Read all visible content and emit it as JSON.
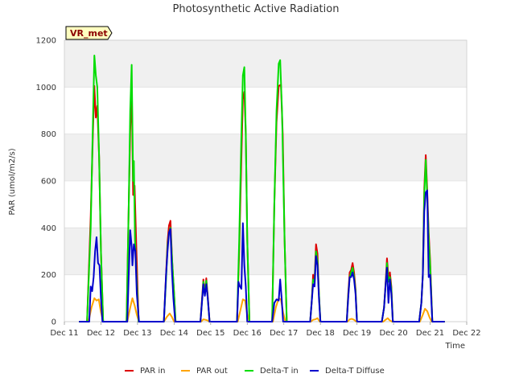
{
  "chart_data": {
    "type": "line",
    "title": "Photosynthetic Active Radiation",
    "xlabel": "Time",
    "ylabel": "PAR (umol/m2/s)",
    "ylim": [
      0,
      1200
    ],
    "xlim": [
      0,
      11
    ],
    "yticks": [
      0,
      200,
      400,
      600,
      800,
      1000,
      1200
    ],
    "xtick_labels": [
      "Dec 11",
      "Dec 12",
      "Dec 13",
      "Dec 14",
      "Dec 15",
      "Dec 16",
      "Dec 17",
      "Dec 18",
      "Dec 19",
      "Dec 20",
      "Dec 21",
      "Dec 22"
    ],
    "grid": true,
    "legend_position": "bottom",
    "badge": "VR_met",
    "series": [
      {
        "name": "PAR in",
        "color": "#dd0000",
        "points": [
          [
            0.4,
            0
          ],
          [
            0.62,
            0
          ],
          [
            0.72,
            450
          ],
          [
            0.78,
            800
          ],
          [
            0.82,
            1005
          ],
          [
            0.86,
            870
          ],
          [
            0.9,
            920
          ],
          [
            0.95,
            700
          ],
          [
            1.0,
            300
          ],
          [
            1.06,
            0
          ],
          [
            1.7,
            0
          ],
          [
            1.76,
            500
          ],
          [
            1.8,
            810
          ],
          [
            1.84,
            1000
          ],
          [
            1.88,
            540
          ],
          [
            1.92,
            580
          ],
          [
            1.97,
            300
          ],
          [
            2.03,
            0
          ],
          [
            2.72,
            0
          ],
          [
            2.78,
            200
          ],
          [
            2.82,
            340
          ],
          [
            2.86,
            410
          ],
          [
            2.9,
            430
          ],
          [
            2.95,
            250
          ],
          [
            3.0,
            120
          ],
          [
            3.04,
            0
          ],
          [
            3.72,
            0
          ],
          [
            3.76,
            90
          ],
          [
            3.8,
            180
          ],
          [
            3.84,
            120
          ],
          [
            3.88,
            185
          ],
          [
            3.92,
            110
          ],
          [
            3.97,
            0
          ],
          [
            4.72,
            0
          ],
          [
            4.78,
            300
          ],
          [
            4.84,
            700
          ],
          [
            4.88,
            950
          ],
          [
            4.92,
            980
          ],
          [
            4.96,
            800
          ],
          [
            5.0,
            350
          ],
          [
            5.06,
            0
          ],
          [
            5.68,
            0
          ],
          [
            5.74,
            500
          ],
          [
            5.8,
            850
          ],
          [
            5.86,
            1005
          ],
          [
            5.92,
            1010
          ],
          [
            5.97,
            800
          ],
          [
            6.02,
            350
          ],
          [
            6.08,
            0
          ],
          [
            6.72,
            0
          ],
          [
            6.76,
            80
          ],
          [
            6.8,
            200
          ],
          [
            6.84,
            180
          ],
          [
            6.88,
            330
          ],
          [
            6.92,
            290
          ],
          [
            6.96,
            120
          ],
          [
            7.0,
            0
          ],
          [
            7.72,
            0
          ],
          [
            7.76,
            120
          ],
          [
            7.8,
            210
          ],
          [
            7.84,
            220
          ],
          [
            7.88,
            250
          ],
          [
            7.92,
            210
          ],
          [
            7.96,
            140
          ],
          [
            8.0,
            0
          ],
          [
            8.68,
            0
          ],
          [
            8.74,
            60
          ],
          [
            8.78,
            160
          ],
          [
            8.82,
            270
          ],
          [
            8.86,
            190
          ],
          [
            8.9,
            210
          ],
          [
            8.94,
            150
          ],
          [
            8.98,
            0
          ],
          [
            9.7,
            0
          ],
          [
            9.76,
            80
          ],
          [
            9.8,
            200
          ],
          [
            9.84,
            570
          ],
          [
            9.88,
            710
          ],
          [
            9.92,
            560
          ],
          [
            9.96,
            380
          ],
          [
            10.0,
            260
          ],
          [
            10.06,
            0
          ],
          [
            10.4,
            0
          ]
        ]
      },
      {
        "name": "PAR out",
        "color": "#ffa500",
        "points": [
          [
            0.4,
            0
          ],
          [
            0.66,
            0
          ],
          [
            0.74,
            60
          ],
          [
            0.82,
            100
          ],
          [
            0.88,
            90
          ],
          [
            0.94,
            95
          ],
          [
            1.0,
            40
          ],
          [
            1.06,
            0
          ],
          [
            1.72,
            0
          ],
          [
            1.8,
            60
          ],
          [
            1.86,
            100
          ],
          [
            1.92,
            70
          ],
          [
            1.98,
            30
          ],
          [
            2.04,
            0
          ],
          [
            2.72,
            0
          ],
          [
            2.8,
            20
          ],
          [
            2.88,
            35
          ],
          [
            2.94,
            20
          ],
          [
            3.0,
            0
          ],
          [
            3.74,
            0
          ],
          [
            3.8,
            10
          ],
          [
            3.86,
            8
          ],
          [
            3.92,
            5
          ],
          [
            3.96,
            0
          ],
          [
            4.74,
            0
          ],
          [
            4.8,
            40
          ],
          [
            4.88,
            95
          ],
          [
            4.94,
            90
          ],
          [
            5.0,
            30
          ],
          [
            5.06,
            0
          ],
          [
            5.7,
            0
          ],
          [
            5.78,
            60
          ],
          [
            5.86,
            100
          ],
          [
            5.92,
            95
          ],
          [
            5.98,
            40
          ],
          [
            6.04,
            0
          ],
          [
            6.74,
            0
          ],
          [
            6.8,
            8
          ],
          [
            6.86,
            10
          ],
          [
            6.92,
            15
          ],
          [
            6.98,
            0
          ],
          [
            7.74,
            0
          ],
          [
            7.8,
            10
          ],
          [
            7.86,
            12
          ],
          [
            7.92,
            8
          ],
          [
            7.98,
            0
          ],
          [
            8.72,
            0
          ],
          [
            8.78,
            8
          ],
          [
            8.84,
            15
          ],
          [
            8.9,
            5
          ],
          [
            8.96,
            0
          ],
          [
            9.72,
            0
          ],
          [
            9.8,
            30
          ],
          [
            9.86,
            55
          ],
          [
            9.92,
            45
          ],
          [
            9.98,
            20
          ],
          [
            10.04,
            0
          ],
          [
            10.4,
            0
          ]
        ]
      },
      {
        "name": "Delta-T in",
        "color": "#00dd00",
        "points": [
          [
            0.4,
            0
          ],
          [
            0.62,
            0
          ],
          [
            0.72,
            400
          ],
          [
            0.78,
            850
          ],
          [
            0.82,
            1135
          ],
          [
            0.86,
            1050
          ],
          [
            0.9,
            1000
          ],
          [
            0.95,
            700
          ],
          [
            1.0,
            300
          ],
          [
            1.06,
            0
          ],
          [
            1.7,
            0
          ],
          [
            1.76,
            500
          ],
          [
            1.8,
            900
          ],
          [
            1.84,
            1095
          ],
          [
            1.88,
            600
          ],
          [
            1.9,
            685
          ],
          [
            1.93,
            350
          ],
          [
            1.97,
            200
          ],
          [
            2.03,
            0
          ],
          [
            2.72,
            0
          ],
          [
            2.78,
            180
          ],
          [
            2.82,
            320
          ],
          [
            2.86,
            380
          ],
          [
            2.9,
            400
          ],
          [
            2.95,
            250
          ],
          [
            3.0,
            120
          ],
          [
            3.04,
            0
          ],
          [
            3.72,
            0
          ],
          [
            3.76,
            80
          ],
          [
            3.8,
            170
          ],
          [
            3.84,
            120
          ],
          [
            3.88,
            175
          ],
          [
            3.92,
            100
          ],
          [
            3.97,
            0
          ],
          [
            4.72,
            0
          ],
          [
            4.78,
            350
          ],
          [
            4.84,
            800
          ],
          [
            4.88,
            1050
          ],
          [
            4.92,
            1085
          ],
          [
            4.96,
            800
          ],
          [
            5.0,
            350
          ],
          [
            5.06,
            0
          ],
          [
            5.68,
            0
          ],
          [
            5.74,
            500
          ],
          [
            5.8,
            900
          ],
          [
            5.86,
            1100
          ],
          [
            5.9,
            1115
          ],
          [
            5.95,
            900
          ],
          [
            6.02,
            350
          ],
          [
            6.08,
            0
          ],
          [
            6.72,
            0
          ],
          [
            6.76,
            80
          ],
          [
            6.8,
            180
          ],
          [
            6.84,
            170
          ],
          [
            6.88,
            300
          ],
          [
            6.92,
            260
          ],
          [
            6.96,
            120
          ],
          [
            7.0,
            0
          ],
          [
            7.72,
            0
          ],
          [
            7.76,
            110
          ],
          [
            7.8,
            190
          ],
          [
            7.84,
            210
          ],
          [
            7.88,
            230
          ],
          [
            7.92,
            190
          ],
          [
            7.96,
            130
          ],
          [
            8.0,
            0
          ],
          [
            8.68,
            0
          ],
          [
            8.74,
            60
          ],
          [
            8.78,
            150
          ],
          [
            8.82,
            250
          ],
          [
            8.86,
            170
          ],
          [
            8.9,
            190
          ],
          [
            8.94,
            140
          ],
          [
            8.98,
            0
          ],
          [
            9.7,
            0
          ],
          [
            9.76,
            80
          ],
          [
            9.8,
            200
          ],
          [
            9.84,
            540
          ],
          [
            9.88,
            690
          ],
          [
            9.92,
            530
          ],
          [
            9.96,
            360
          ],
          [
            10.0,
            240
          ],
          [
            10.06,
            0
          ],
          [
            10.4,
            0
          ]
        ]
      },
      {
        "name": "Delta-T Diffuse",
        "color": "#0000cc",
        "points": [
          [
            0.4,
            0
          ],
          [
            0.68,
            0
          ],
          [
            0.72,
            150
          ],
          [
            0.76,
            130
          ],
          [
            0.8,
            190
          ],
          [
            0.84,
            300
          ],
          [
            0.88,
            360
          ],
          [
            0.92,
            250
          ],
          [
            0.96,
            240
          ],
          [
            1.0,
            100
          ],
          [
            1.04,
            0
          ],
          [
            1.72,
            0
          ],
          [
            1.76,
            200
          ],
          [
            1.8,
            390
          ],
          [
            1.84,
            320
          ],
          [
            1.86,
            240
          ],
          [
            1.9,
            330
          ],
          [
            1.94,
            300
          ],
          [
            1.98,
            120
          ],
          [
            2.04,
            0
          ],
          [
            2.72,
            0
          ],
          [
            2.78,
            200
          ],
          [
            2.82,
            300
          ],
          [
            2.86,
            380
          ],
          [
            2.9,
            395
          ],
          [
            2.94,
            220
          ],
          [
            2.98,
            100
          ],
          [
            3.03,
            0
          ],
          [
            3.72,
            0
          ],
          [
            3.76,
            80
          ],
          [
            3.8,
            160
          ],
          [
            3.84,
            110
          ],
          [
            3.88,
            160
          ],
          [
            3.92,
            100
          ],
          [
            3.97,
            0
          ],
          [
            4.72,
            0
          ],
          [
            4.76,
            170
          ],
          [
            4.8,
            150
          ],
          [
            4.84,
            140
          ],
          [
            4.88,
            420
          ],
          [
            4.92,
            240
          ],
          [
            4.96,
            150
          ],
          [
            5.0,
            0
          ],
          [
            5.68,
            0
          ],
          [
            5.74,
            80
          ],
          [
            5.8,
            95
          ],
          [
            5.86,
            90
          ],
          [
            5.9,
            180
          ],
          [
            5.94,
            100
          ],
          [
            5.98,
            0
          ],
          [
            6.72,
            0
          ],
          [
            6.76,
            80
          ],
          [
            6.8,
            160
          ],
          [
            6.84,
            150
          ],
          [
            6.88,
            280
          ],
          [
            6.92,
            240
          ],
          [
            6.96,
            100
          ],
          [
            7.0,
            0
          ],
          [
            7.72,
            0
          ],
          [
            7.76,
            100
          ],
          [
            7.8,
            190
          ],
          [
            7.84,
            190
          ],
          [
            7.88,
            210
          ],
          [
            7.92,
            180
          ],
          [
            7.96,
            120
          ],
          [
            8.0,
            0
          ],
          [
            8.68,
            0
          ],
          [
            8.74,
            60
          ],
          [
            8.78,
            150
          ],
          [
            8.82,
            230
          ],
          [
            8.86,
            80
          ],
          [
            8.9,
            180
          ],
          [
            8.94,
            120
          ],
          [
            8.98,
            0
          ],
          [
            9.7,
            0
          ],
          [
            9.76,
            80
          ],
          [
            9.8,
            200
          ],
          [
            9.84,
            470
          ],
          [
            9.88,
            550
          ],
          [
            9.92,
            560
          ],
          [
            9.96,
            190
          ],
          [
            10.0,
            200
          ],
          [
            10.06,
            0
          ],
          [
            10.4,
            0
          ]
        ]
      }
    ]
  }
}
